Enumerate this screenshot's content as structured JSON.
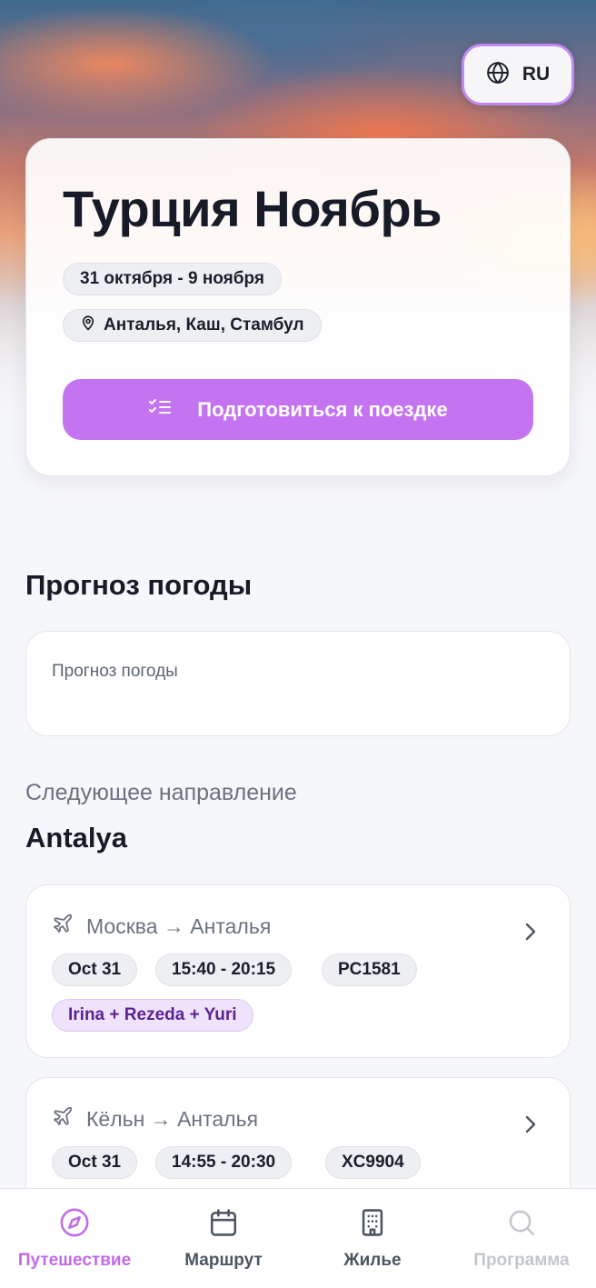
{
  "language": {
    "code": "RU",
    "icon": "globe-icon"
  },
  "trip": {
    "title": "Турция Ноябрь",
    "dates": "31 октября - 9 ноября",
    "locations": "Анталья, Каш, Стамбул",
    "prepare_button": "Подготовиться к поездке"
  },
  "weather": {
    "heading": "Прогноз погоды",
    "card_text": "Прогноз погоды"
  },
  "next_destination": {
    "label": "Следующее направление",
    "name": "Antalya"
  },
  "flights": [
    {
      "route": "Москва → Анталья",
      "date": "Oct 31",
      "time": "15:40 - 20:15",
      "code": "PC1581",
      "people": "Irina + Rezeda + Yuri"
    },
    {
      "route": "Кёльн → Анталья",
      "date": "Oct 31",
      "time": "14:55 - 20:30",
      "code": "XC9904"
    }
  ],
  "nav": [
    {
      "label": "Путешествие",
      "icon": "compass-icon",
      "state": "active"
    },
    {
      "label": "Маршрут",
      "icon": "calendar-icon",
      "state": "normal"
    },
    {
      "label": "Жилье",
      "icon": "building-icon",
      "state": "normal"
    },
    {
      "label": "Программа",
      "icon": "search-icon",
      "state": "disabled"
    }
  ],
  "colors": {
    "accent": "#c474f0",
    "active_nav": "#c26ae8",
    "people_chip_text": "#5b2490"
  }
}
